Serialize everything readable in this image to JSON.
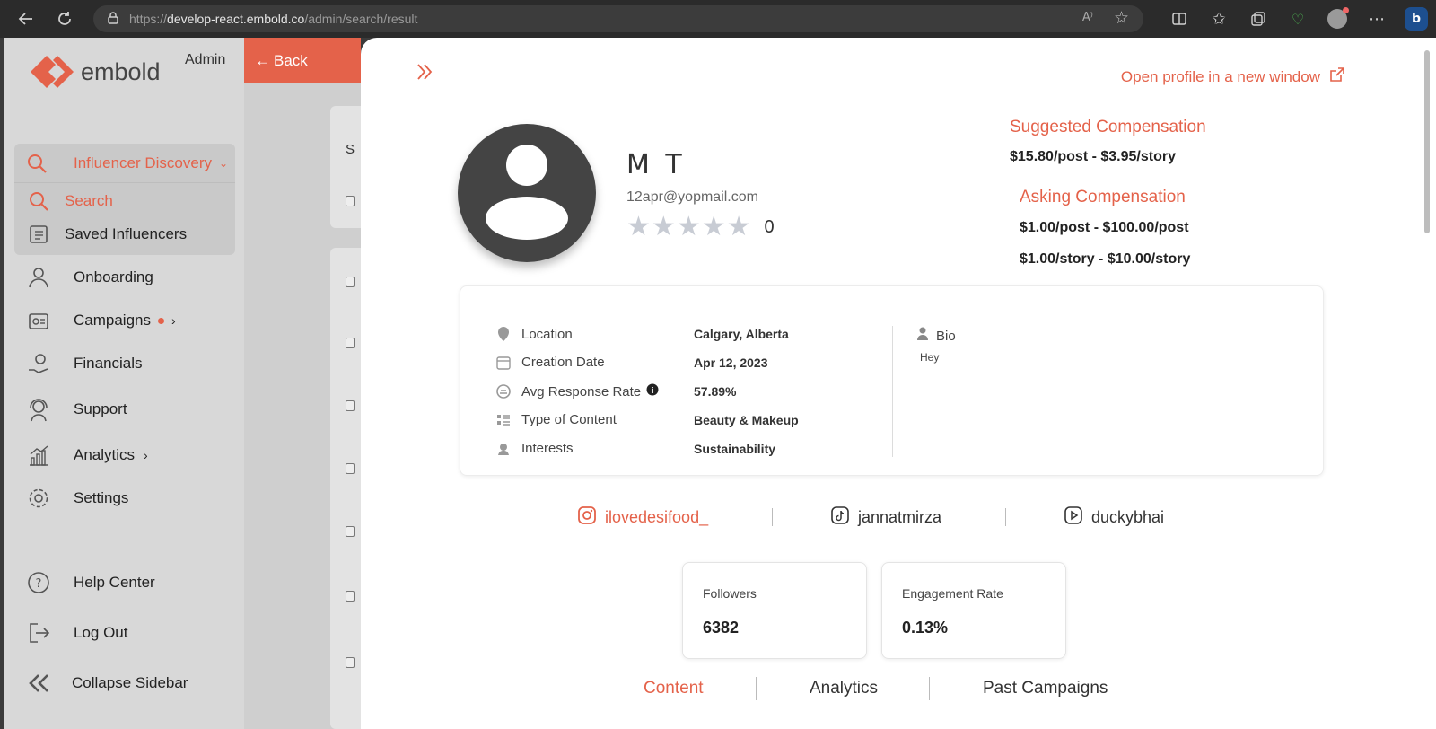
{
  "browser": {
    "url_prefix": "https://",
    "url_host": "develop-react.embold.co",
    "url_path": "/admin/search/result"
  },
  "sidebar": {
    "logo_text": "embold",
    "admin_label": "Admin",
    "discovery_label": "Influencer Discovery",
    "search_label": "Search",
    "saved_label": "Saved Influencers",
    "items": [
      {
        "label": "Onboarding"
      },
      {
        "label": "Campaigns"
      },
      {
        "label": "Financials"
      },
      {
        "label": "Support"
      },
      {
        "label": "Analytics"
      },
      {
        "label": "Settings"
      },
      {
        "label": "Help Center"
      },
      {
        "label": "Log Out"
      },
      {
        "label": "Collapse Sidebar"
      }
    ]
  },
  "background_page": {
    "back_label": "Back",
    "partial_letter": "S"
  },
  "profile": {
    "open_link": "Open profile in a new window",
    "name": "M T",
    "email": "12apr@yopmail.com",
    "rating": "0",
    "suggested_title": "Suggested Compensation",
    "suggested_value": "$15.80/post - $3.95/story",
    "asking_title": "Asking Compensation",
    "asking_post": "$1.00/post - $100.00/post",
    "asking_story": "$1.00/story - $10.00/story",
    "details": [
      {
        "icon": "location-pin-icon",
        "label": "Location",
        "value": "Calgary, Alberta"
      },
      {
        "icon": "calendar-icon",
        "label": "Creation Date",
        "value": "Apr 12, 2023"
      },
      {
        "icon": "response-rate-icon",
        "label": "Avg Response Rate",
        "value": "57.89%"
      },
      {
        "icon": "content-type-icon",
        "label": "Type of Content",
        "value": "Beauty & Makeup"
      },
      {
        "icon": "interests-icon",
        "label": "Interests",
        "value": "Sustainability"
      }
    ],
    "bio_label": "Bio",
    "bio_text": "Hey",
    "socials": {
      "instagram": "ilovedesifood_",
      "tiktok": "jannatmirza",
      "youtube": "duckybhai"
    },
    "stats": {
      "followers_label": "Followers",
      "followers_value": "6382",
      "engagement_label": "Engagement Rate",
      "engagement_value": "0.13%"
    },
    "tabs": [
      "Content",
      "Analytics",
      "Past Campaigns"
    ]
  },
  "colors": {
    "accent": "#e4624a",
    "sidebar_bg": "#d8d8d8",
    "browser_bg": "#2b2b2b"
  }
}
